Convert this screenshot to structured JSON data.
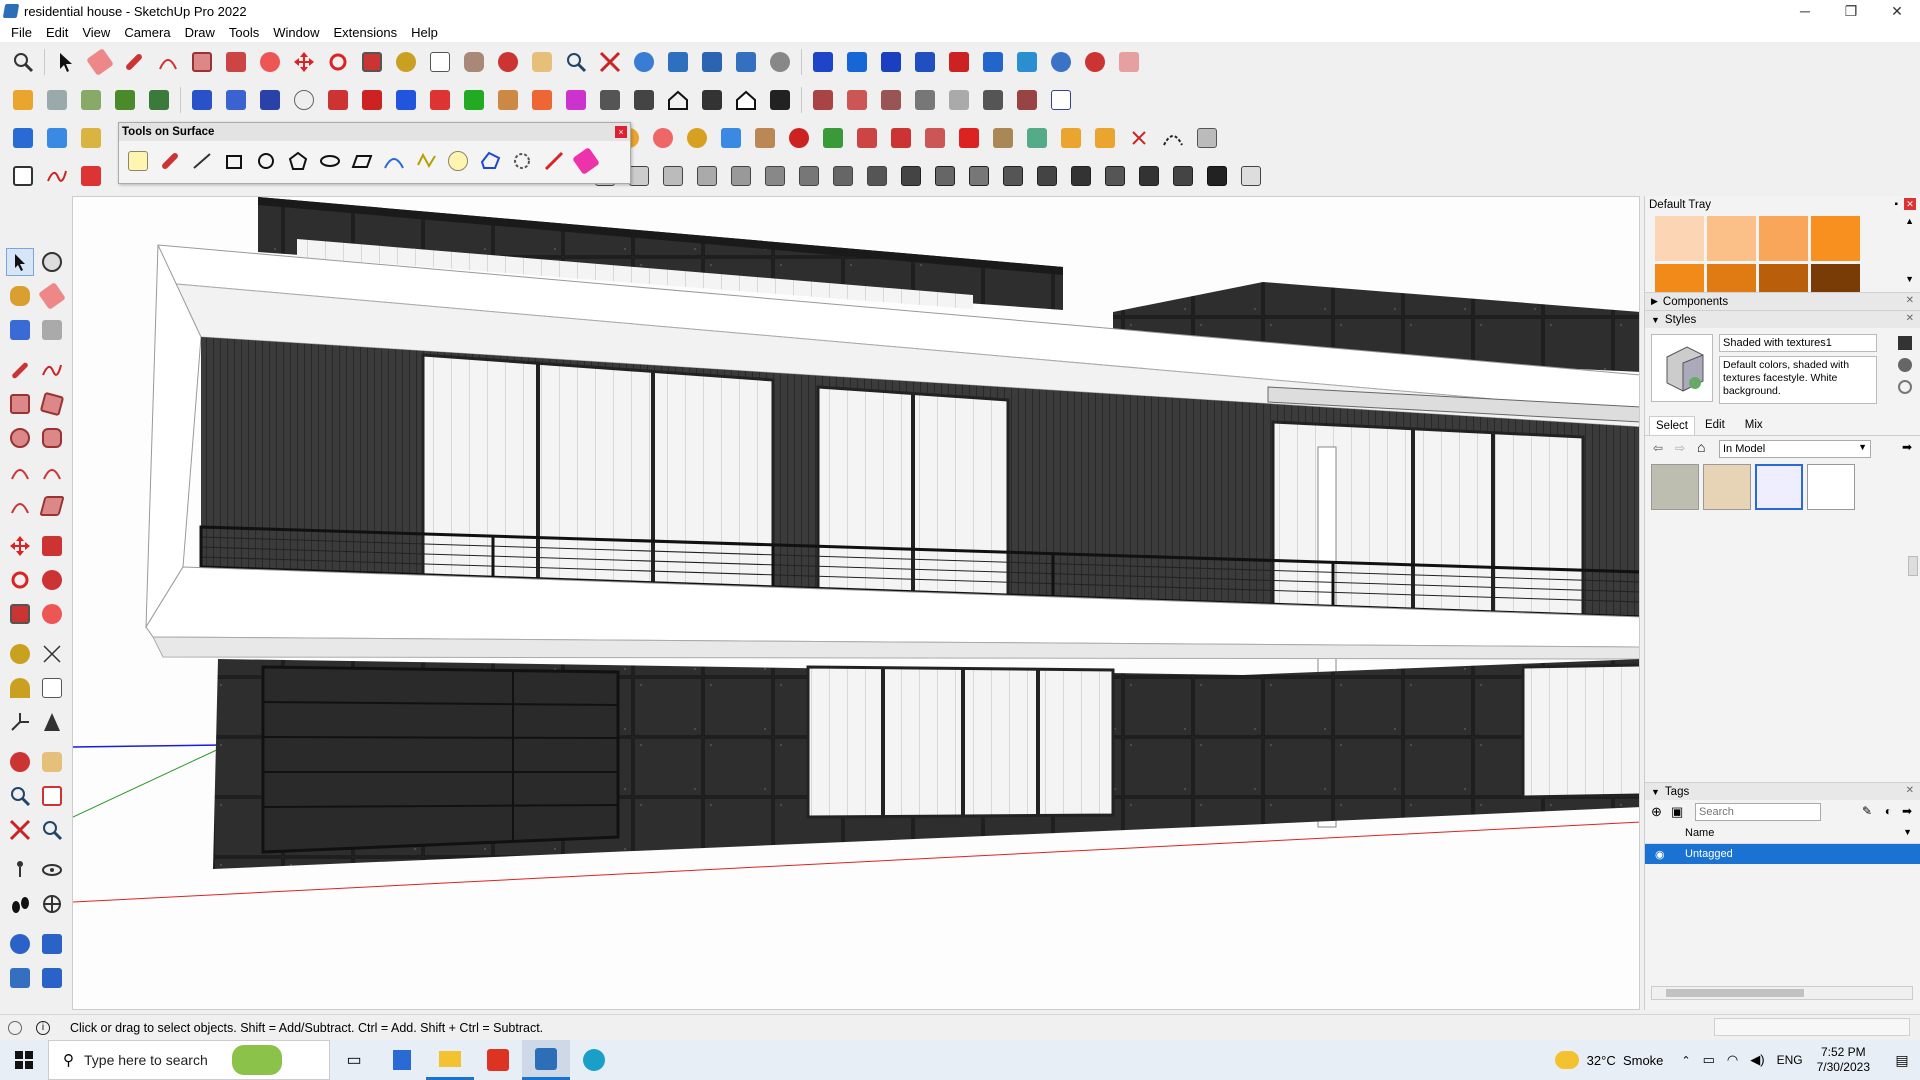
{
  "window": {
    "title": "residential house - SketchUp Pro 2022",
    "minimize": "─",
    "maximize": "❐",
    "close": "✕"
  },
  "menu": [
    "File",
    "Edit",
    "View",
    "Camera",
    "Draw",
    "Tools",
    "Window",
    "Extensions",
    "Help"
  ],
  "tools_on_surface": {
    "title": "Tools on Surface",
    "close": "×"
  },
  "tray": {
    "title": "Default Tray",
    "swatch_colors": [
      "#fcd5b5",
      "#fbbf88",
      "#f9a55a",
      "#f7901e",
      "#f28a1a",
      "#e07a12",
      "#b95e0a",
      "#7a3c06"
    ],
    "components": {
      "label": "Components"
    },
    "styles": {
      "label": "Styles",
      "style_name": "Shaded with textures1",
      "style_desc": "Default colors, shaded with textures facestyle. White background.",
      "tabs": [
        "Select",
        "Edit",
        "Mix"
      ],
      "dropdown": "In Model"
    },
    "tags": {
      "label": "Tags",
      "search_placeholder": "Search",
      "column": "Name",
      "rows": [
        "Untagged"
      ]
    }
  },
  "status": {
    "hint": "Click or drag to select objects. Shift = Add/Subtract. Ctrl = Add. Shift + Ctrl = Subtract."
  },
  "taskbar": {
    "search_placeholder": "Type here to search",
    "weather": "32°C  Smoke",
    "lang": "ENG",
    "time": "7:52 PM",
    "date": "7/30/2023"
  }
}
